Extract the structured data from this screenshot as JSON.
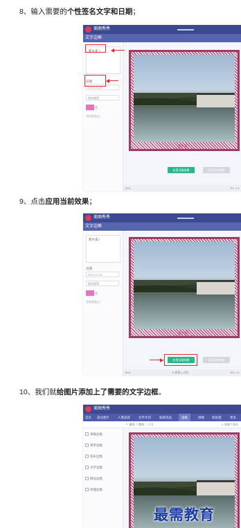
{
  "steps": [
    {
      "num": "8、",
      "pre": "输入需要的",
      "bold": "个性签名文字和日期",
      "post": "；"
    },
    {
      "num": "9、",
      "pre": "点击",
      "bold": "应用当前效果",
      "post": "；"
    },
    {
      "num": "10、",
      "pre": "我们就",
      "bold": "给图片添加上了需要的文字边框",
      "post": "。"
    }
  ],
  "app": {
    "name": "美图秀秀",
    "panel_title": "文字边框",
    "signature_text": "家乡美丨",
    "date_label": "日期",
    "date_value": "2019-10-28",
    "font_select": "微软雅黑",
    "color_label": "色",
    "checkbox_label": "添加渐变(2)",
    "preview_name": "家乡美！",
    "preview_date": "2019 - 10 - 28",
    "apply_button": "应用当前效果",
    "cancel_button": "取消当前效果",
    "zoom": "80%",
    "status_right": "761 × 5",
    "status_mid": "↺ 原图 ⤓ 对比"
  },
  "app3": {
    "tabs": [
      "首页",
      "美化图片",
      "人像美容",
      "文字水印",
      "贴纸饰品",
      "边框",
      "拼图",
      "批处理",
      "更多"
    ],
    "toolbar": "↶ 撤销  ↷ 重做  ⬚ 尺寸",
    "toolbar_right": "⇐ 原图   ⤒ 保存",
    "menu": [
      "海报边框",
      "简单边框",
      "炫彩边框",
      "文字边框",
      "撕边边框",
      "纹理边框"
    ]
  },
  "watermark": "最需教育",
  "colors": {
    "accent": "#e02b2b",
    "frame": "#9a3c63",
    "apply": "#2bb58a",
    "topbar": "#3b4a8f"
  }
}
